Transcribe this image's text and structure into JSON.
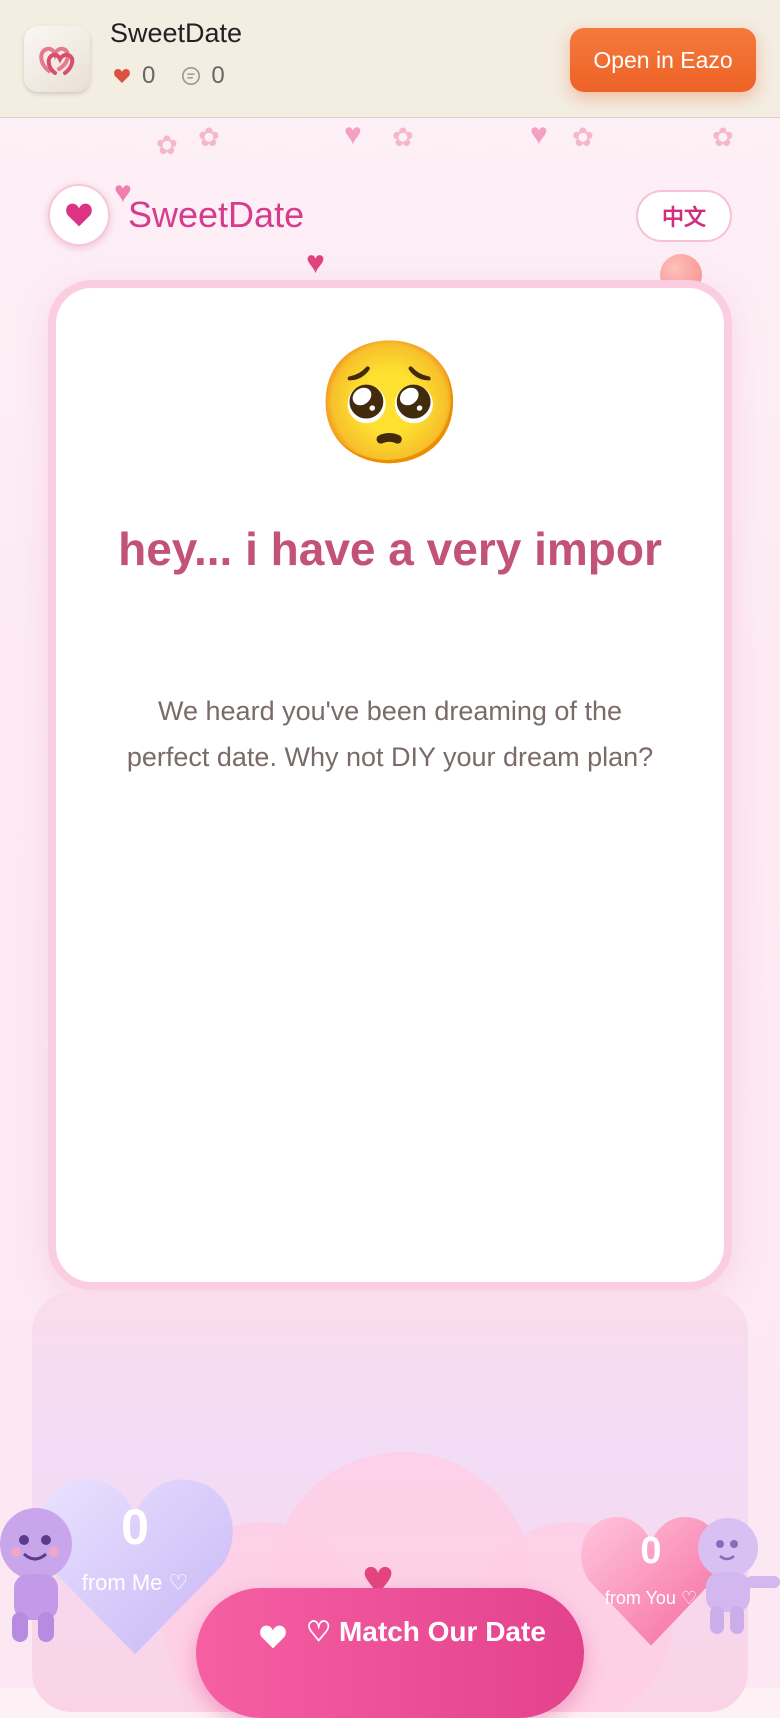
{
  "topbar": {
    "app_name": "SweetDate",
    "likes_count": "0",
    "comments_count": "0",
    "open_button_label": "Open in Eazo"
  },
  "header": {
    "brand": "SweetDate",
    "language_button": "中文"
  },
  "card": {
    "emoji": "🥺",
    "title": "hey... i have a very impor",
    "body": "We heard you've been dreaming of the perfect date. Why not DIY your dream plan?"
  },
  "bottom": {
    "me_count": "0",
    "me_label": "from Me ♡",
    "you_count": "0",
    "you_label": "from You ♡",
    "match_button_label": "♡ Match Our Date"
  },
  "colors": {
    "accent": "#d63c8c",
    "open_button": "#ee6226",
    "title": "#c2527a"
  }
}
